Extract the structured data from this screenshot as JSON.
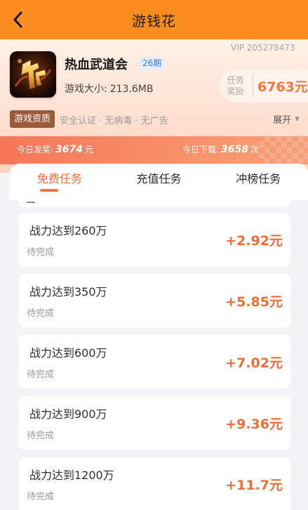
{
  "topbar": {
    "title": "游钱花"
  },
  "header": {
    "vip_id": "VIP 205278473",
    "game_title": "热血武道会",
    "period_badge": "26期",
    "size_label": "游戏大小:",
    "size_value": "213.6MB",
    "reward_label_line1": "任务",
    "reward_label_line2": "奖励",
    "reward_amount": "6763元",
    "tag_chip": "游戏资质",
    "tag_desc": "安全认证 · 无病毒 · 无广告",
    "expand_label": "展开"
  },
  "stats": {
    "payout_label": "今日发奖:",
    "payout_value": "3674",
    "payout_unit": "元",
    "download_label": "今日下载:",
    "download_value": "3658",
    "download_unit": "次"
  },
  "tabs": [
    {
      "label": "免费任务"
    },
    {
      "label": "充值任务"
    },
    {
      "label": "冲榜任务"
    }
  ],
  "tasks": [
    {
      "title": "战力达到260万",
      "status": "待完成",
      "reward": "+2.92元"
    },
    {
      "title": "战力达到350万",
      "status": "待完成",
      "reward": "+5.85元"
    },
    {
      "title": "战力达到600万",
      "status": "待完成",
      "reward": "+7.02元"
    },
    {
      "title": "战力达到900万",
      "status": "待完成",
      "reward": "+9.36元"
    },
    {
      "title": "战力达到1200万",
      "status": "待完成",
      "reward": "+11.7元"
    }
  ],
  "colors": {
    "topbar": "#fb8c1e",
    "accent": "#f36b35",
    "badge_text": "#3d79e2",
    "tag_chip": "#9b5a3a"
  },
  "icons": {
    "back": "chevron-left-icon",
    "expand": "caret-down-icon",
    "logo": "game-logo"
  }
}
